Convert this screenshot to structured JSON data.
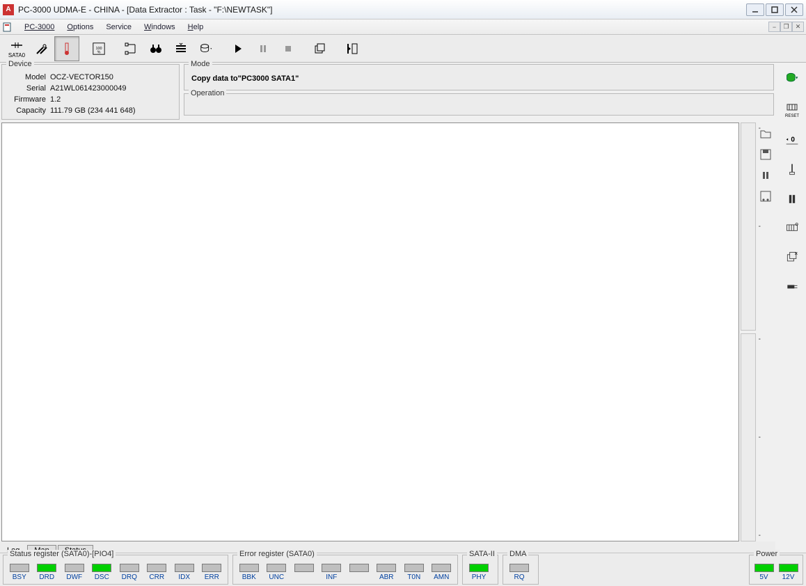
{
  "title": "PC-3000 UDMA-E - CHINA - [Data Extractor : Task - \"F:\\NEWTASK\"]",
  "menus": {
    "pc3000": "PC-3000",
    "options": "Options",
    "service": "Service",
    "windows": "Windows",
    "help": "Help"
  },
  "toolbar": {
    "sata_label": "SATA0",
    "percent_label": "100%"
  },
  "device": {
    "legend": "Device",
    "model_k": "Model",
    "model_v": "OCZ-VECTOR150",
    "serial_k": "Serial",
    "serial_v": "A21WL061423000049",
    "firmware_k": "Firmware",
    "firmware_v": "1.2",
    "capacity_k": "Capacity",
    "capacity_v": "111.79 GB (234 441 648)"
  },
  "mode": {
    "legend": "Mode",
    "text": "Copy data to\"PC3000 SATA1\""
  },
  "operation": {
    "legend": "Operation"
  },
  "mini_ticks": [
    "-",
    "-",
    "-",
    "-",
    "-"
  ],
  "tabs": {
    "log": "Log",
    "map": "Map",
    "status": "Status"
  },
  "status_register": {
    "legend": "Status register (SATA0)-[PIO4]",
    "items": [
      {
        "label": "BSY",
        "on": false
      },
      {
        "label": "DRD",
        "on": true
      },
      {
        "label": "DWF",
        "on": false
      },
      {
        "label": "DSC",
        "on": true
      },
      {
        "label": "DRQ",
        "on": false
      },
      {
        "label": "CRR",
        "on": false
      },
      {
        "label": "IDX",
        "on": false
      },
      {
        "label": "ERR",
        "on": false
      }
    ]
  },
  "error_register": {
    "legend": "Error register (SATA0)",
    "items": [
      {
        "label": "BBK",
        "on": false
      },
      {
        "label": "UNC",
        "on": false
      },
      {
        "label": "",
        "on": false
      },
      {
        "label": "INF",
        "on": false
      },
      {
        "label": "",
        "on": false
      },
      {
        "label": "ABR",
        "on": false
      },
      {
        "label": "T0N",
        "on": false
      },
      {
        "label": "AMN",
        "on": false
      }
    ]
  },
  "sata2": {
    "legend": "SATA-II",
    "items": [
      {
        "label": "PHY",
        "on": true
      }
    ]
  },
  "dma": {
    "legend": "DMA",
    "items": [
      {
        "label": "RQ",
        "on": false
      }
    ]
  },
  "power": {
    "legend": "Power",
    "items": [
      {
        "label": "5V",
        "on": true
      },
      {
        "label": "12V",
        "on": true
      }
    ]
  },
  "far_right_reset": "RESET"
}
